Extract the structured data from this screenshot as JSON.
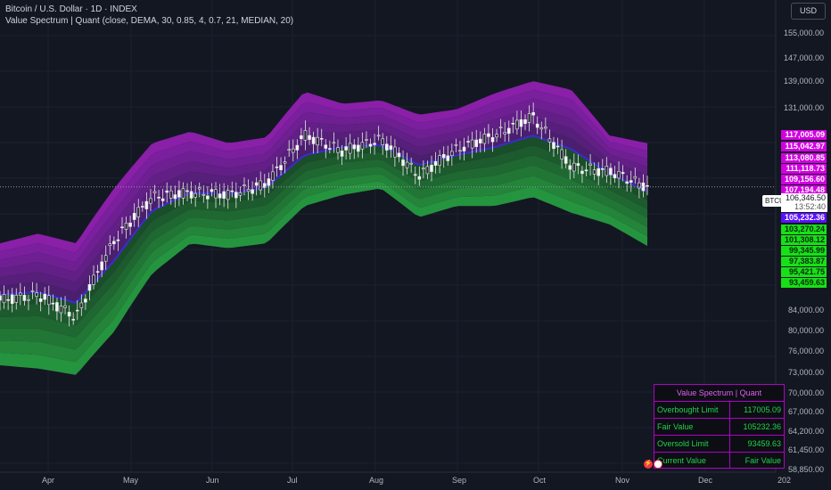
{
  "header": {
    "symbol_line": "Bitcoin / U.S. Dollar · 1D · INDEX",
    "indicator_line": "Value Spectrum | Quant (close, DEMA, 30, 0.85, 4, 0.7, 21, MEDIAN, 20)"
  },
  "currency_button": "USD",
  "ticker": "BTCUSD",
  "current_price": "106,346.50",
  "countdown": "13:52:40",
  "colors": {
    "background": "#131722",
    "overbought_band": "#8a1fa0",
    "oversold_band": "#1f8f2e",
    "fair_line": "#3a2ccf",
    "candle": "#e8e8e8",
    "label_overbought": "#d100e0",
    "label_fair": "#5a10ff",
    "label_oversold": "#18e018"
  },
  "level_labels": [
    {
      "text": "117,005.09",
      "kind": "ob"
    },
    {
      "text": "115,042.97",
      "kind": "ob"
    },
    {
      "text": "113,080.85",
      "kind": "ob"
    },
    {
      "text": "111,118.73",
      "kind": "ob"
    },
    {
      "text": "109,156.60",
      "kind": "ob"
    },
    {
      "text": "107,194.48",
      "kind": "ob"
    },
    {
      "text": "105,232.36",
      "kind": "fair"
    },
    {
      "text": "103,270.24",
      "kind": "os"
    },
    {
      "text": "101,308.12",
      "kind": "os"
    },
    {
      "text": "99,345.99",
      "kind": "os"
    },
    {
      "text": "97,383.87",
      "kind": "os"
    },
    {
      "text": "95,421.75",
      "kind": "os"
    },
    {
      "text": "93,459.63",
      "kind": "os"
    }
  ],
  "y_axis": {
    "labels": [
      "155,000.00",
      "147,000.00",
      "139,000.00",
      "131,000.00",
      "84,000.00",
      "80,000.00",
      "76,000.00",
      "73,000.00",
      "70,000.00",
      "67,000.00",
      "64,200.00",
      "61,450.00",
      "58,850.00"
    ]
  },
  "x_axis": {
    "labels": [
      "Apr",
      "May",
      "Jun",
      "Jul",
      "Aug",
      "Sep",
      "Oct",
      "Nov",
      "Dec",
      "202"
    ]
  },
  "info_table": {
    "title": "Value Spectrum | Quant",
    "rows": [
      {
        "key": "Overbought Limit",
        "value": "117005.09"
      },
      {
        "key": "Fair Value",
        "value": "105232.36"
      },
      {
        "key": "Oversold Limit",
        "value": "93459.63"
      },
      {
        "key": "Current Value",
        "value": "Fair Value"
      }
    ]
  },
  "chart_data": {
    "type": "line",
    "x": [
      "Mar 15",
      "Apr 1",
      "Apr 15",
      "May 1",
      "May 15",
      "Jun 1",
      "Jun 15",
      "Jul 1",
      "Jul 15",
      "Aug 1",
      "Aug 15",
      "Sep 1",
      "Sep 15",
      "Oct 1",
      "Oct 8",
      "Oct 15",
      "Nov 1",
      "Nov 10"
    ],
    "series": [
      {
        "name": "Close",
        "values": [
          83000,
          84000,
          80000,
          94500,
          104000,
          105000,
          104500,
          107000,
          119000,
          115000,
          118000,
          109000,
          115500,
          119000,
          124000,
          111000,
          110000,
          106346
        ]
      },
      {
        "name": "Fair Value",
        "values": [
          84000,
          84500,
          82500,
          90500,
          101000,
          105000,
          104600,
          106200,
          114000,
          116000,
          116500,
          111500,
          114000,
          116000,
          119000,
          115500,
          109500,
          105232
        ]
      },
      {
        "name": "Overbought Limit",
        "values": [
          94000,
          96000,
          94000,
          106000,
          117000,
          120000,
          117000,
          118500,
          131000,
          127500,
          128500,
          124500,
          126000,
          130500,
          134000,
          131500,
          119000,
          117005
        ]
      },
      {
        "name": "Oversold Limit",
        "values": [
          72000,
          71500,
          70500,
          77500,
          88000,
          94000,
          93000,
          94000,
          102000,
          104500,
          106000,
          99500,
          102000,
          102000,
          104000,
          100500,
          98000,
          93460
        ]
      }
    ],
    "ylim": [
      57000,
      160000
    ],
    "y_scale": "log",
    "grid": true
  }
}
